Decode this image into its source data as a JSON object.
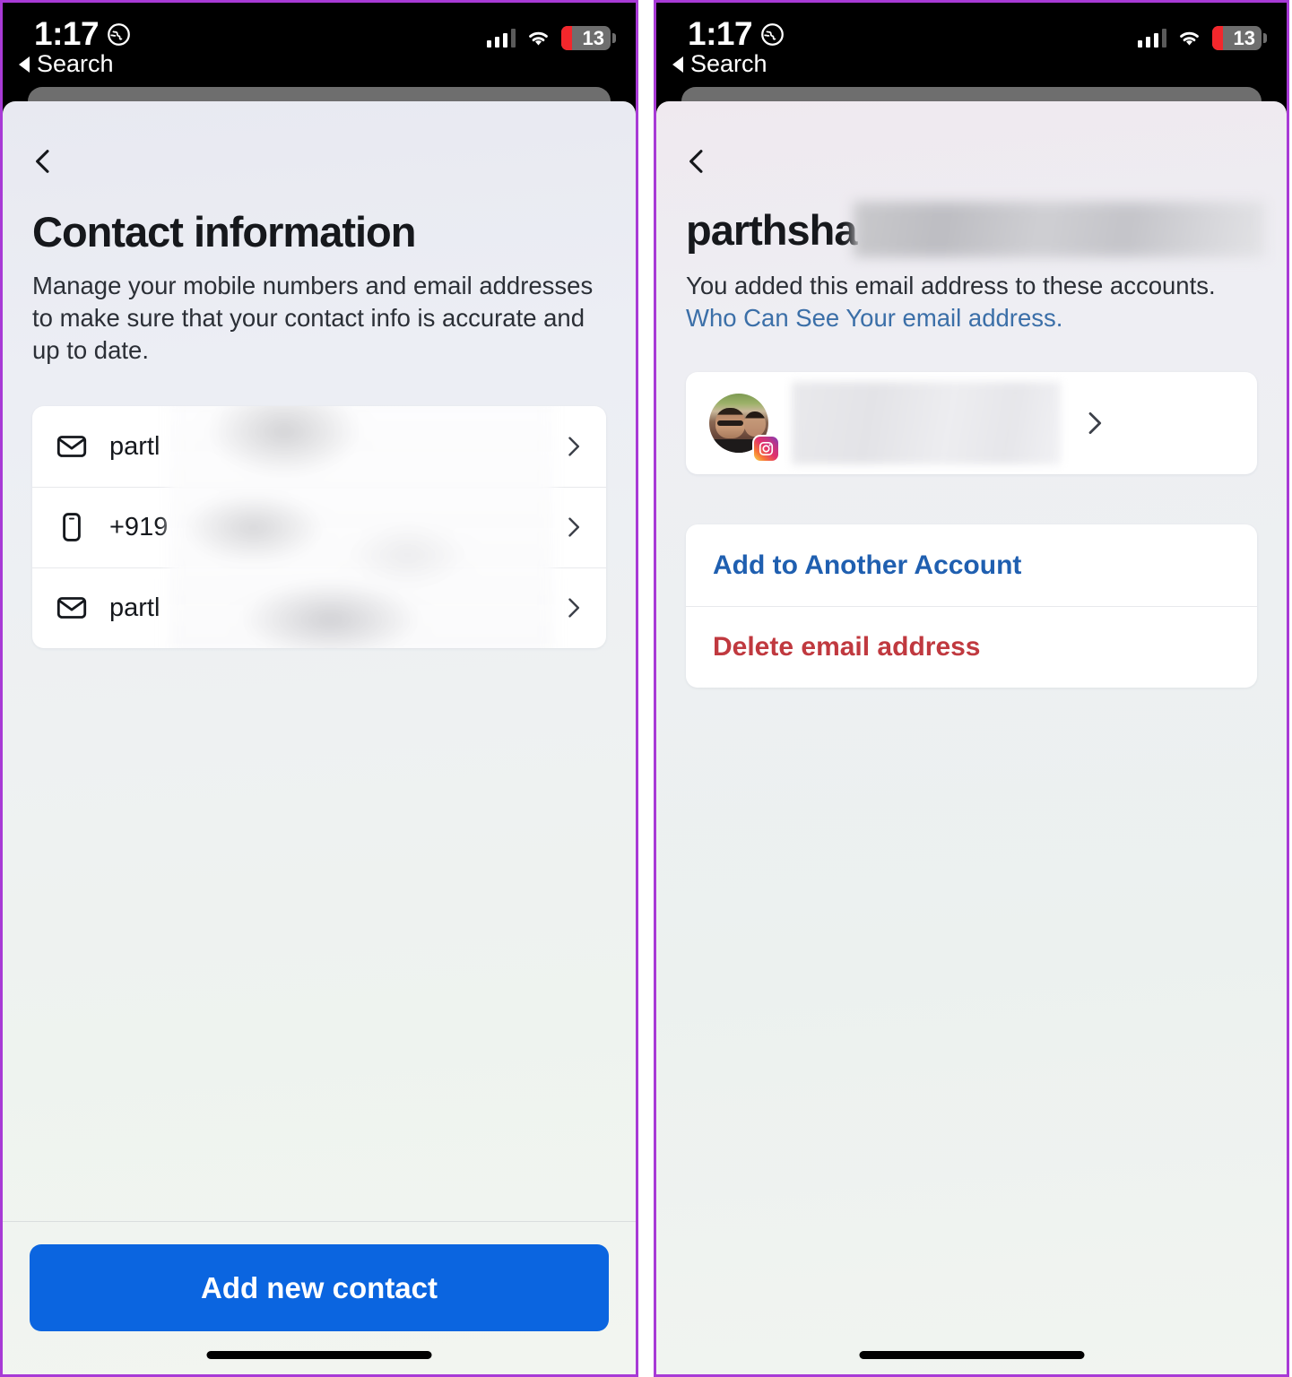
{
  "status_bar": {
    "time": "1:17",
    "location_icon": "globe-icon",
    "back_label": "Search",
    "signal_icon": "cellular-signal-icon",
    "wifi_icon": "wifi-icon",
    "battery_level": "13"
  },
  "left_screen": {
    "back_icon": "chevron-left-icon",
    "title": "Contact information",
    "subtitle": "Manage your mobile numbers and email addresses to make sure that your contact info is accurate and up to date.",
    "contacts": [
      {
        "icon": "envelope-icon",
        "label": "partl",
        "chevron": "chevron-right-icon"
      },
      {
        "icon": "mobile-phone-icon",
        "label": "+919",
        "chevron": "chevron-right-icon"
      },
      {
        "icon": "envelope-icon",
        "label": "partl",
        "chevron": "chevron-right-icon"
      }
    ],
    "cta_label": "Add new contact"
  },
  "right_screen": {
    "back_icon": "chevron-left-icon",
    "title": "parthsha",
    "description_plain": "You added this email address to these accounts. ",
    "description_link": "Who Can See Your email address.",
    "account_row": {
      "avatar": "user-avatar",
      "platform_badge": "instagram-icon",
      "chevron": "chevron-right-icon"
    },
    "actions": [
      {
        "label": "Add to Another Account",
        "kind": "add"
      },
      {
        "label": "Delete email address",
        "kind": "delete"
      }
    ]
  },
  "colors": {
    "primary_blue": "#0b65e0",
    "link_blue": "#3b6fa8",
    "action_blue": "#1f5fb0",
    "danger_red": "#c0393f",
    "title_dark": "#16181c",
    "frame_purple": "#a83ad6",
    "battery_red": "#f3272c"
  }
}
